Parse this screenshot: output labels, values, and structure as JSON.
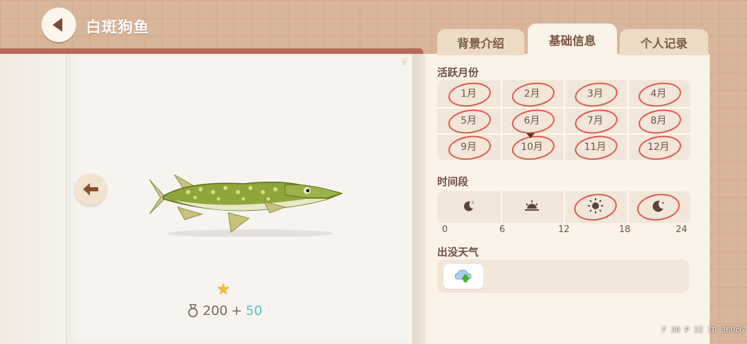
{
  "header": {
    "title": "白斑狗鱼"
  },
  "tabs": [
    {
      "label": "背景介绍",
      "active": false
    },
    {
      "label": "基础信息",
      "active": true
    },
    {
      "label": "个人记录",
      "active": false
    }
  ],
  "active_months": {
    "label": "活跃月份",
    "months": [
      "1月",
      "2月",
      "3月",
      "4月",
      "5月",
      "6月",
      "7月",
      "8月",
      "9月",
      "10月",
      "11月",
      "12月"
    ],
    "active": [
      true,
      true,
      true,
      true,
      true,
      true,
      true,
      true,
      true,
      true,
      true,
      true
    ],
    "current": "10月"
  },
  "time_period": {
    "label": "时间段",
    "slots": [
      {
        "icon": "moon-sleep-icon",
        "active": false
      },
      {
        "icon": "sunrise-icon",
        "active": false
      },
      {
        "icon": "sun-icon",
        "active": true,
        "current": true
      },
      {
        "icon": "moon-night-icon",
        "active": true
      }
    ],
    "ticks": [
      "0",
      "6",
      "12",
      "18",
      "24"
    ]
  },
  "weather": {
    "label": "出没天气",
    "items": [
      {
        "icon": "cloudy-clover-icon"
      }
    ]
  },
  "fish": {
    "rarity_stars": 1,
    "reward_base": "200",
    "reward_plus": "+",
    "reward_bonus": "50"
  },
  "debug": {
    "text": "F 30   P 32   ID 360c6"
  },
  "colors": {
    "accent_red": "#e0564f",
    "bonus_teal": "#4fc4c4"
  }
}
